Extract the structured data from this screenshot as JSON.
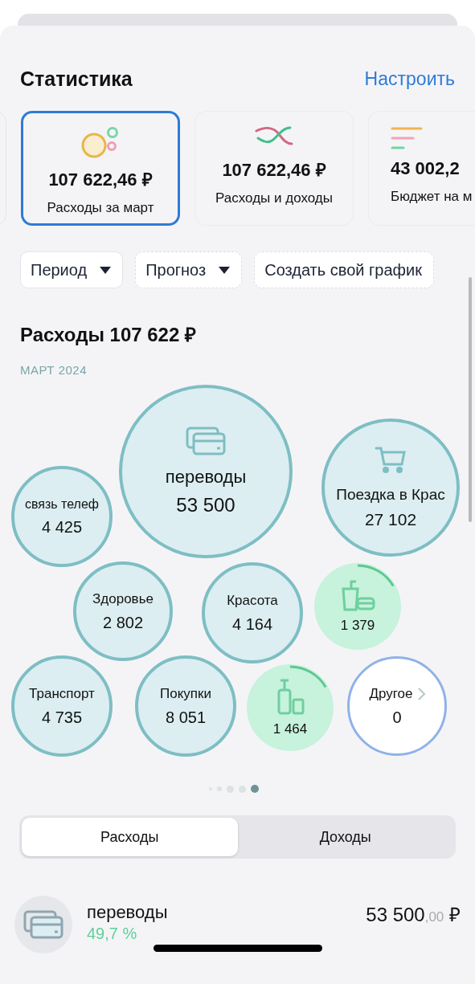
{
  "header": {
    "title": "Статистика",
    "action": "Настроить"
  },
  "stat_cards": [
    {
      "kind": "bubbles",
      "amount": "107 622,46 ₽",
      "label": "Расходы за март",
      "selected": true
    },
    {
      "kind": "lines",
      "amount": "107 622,46 ₽",
      "label": "Расходы и доходы",
      "selected": false
    },
    {
      "kind": "bars",
      "amount": "43 002,2",
      "label": "Бюджет на м",
      "selected": false
    }
  ],
  "filters": [
    {
      "kind": "select",
      "label": "Период"
    },
    {
      "kind": "toggle",
      "label": "Прогноз"
    },
    {
      "kind": "action",
      "label": "Создать свой график"
    }
  ],
  "section": {
    "title": "Расходы 107 622 ₽",
    "subtitle": "МАРТ 2024"
  },
  "bubbles": [
    {
      "kind": "category",
      "label": "связь телеф",
      "value": "4 425"
    },
    {
      "kind": "card",
      "label": "переводы",
      "value": "53 500"
    },
    {
      "kind": "cart",
      "label": "Поездка в Крас",
      "value": "27 102"
    },
    {
      "kind": "category",
      "label": "Здоровье",
      "value": "2 802"
    },
    {
      "kind": "category",
      "label": "Красота",
      "value": "4 164"
    },
    {
      "kind": "drink",
      "value": "1 379"
    },
    {
      "kind": "category",
      "label": "Транспорт",
      "value": "4 735"
    },
    {
      "kind": "category",
      "label": "Покупки",
      "value": "8 051"
    },
    {
      "kind": "bottle",
      "value": "1 464"
    },
    {
      "kind": "other",
      "label": "Другое",
      "value": "0"
    }
  ],
  "pager": [
    {
      "selected": false
    },
    {
      "selected": false
    },
    {
      "selected": false
    },
    {
      "selected": false
    },
    {
      "selected": true
    }
  ],
  "segments": [
    {
      "label": "Расходы",
      "selected": true
    },
    {
      "label": "Доходы",
      "selected": false
    }
  ],
  "list": [
    {
      "name": "переводы",
      "percent": "49,7 %",
      "amount": "53 500",
      "cents": ",00",
      "currency": "₽"
    }
  ]
}
